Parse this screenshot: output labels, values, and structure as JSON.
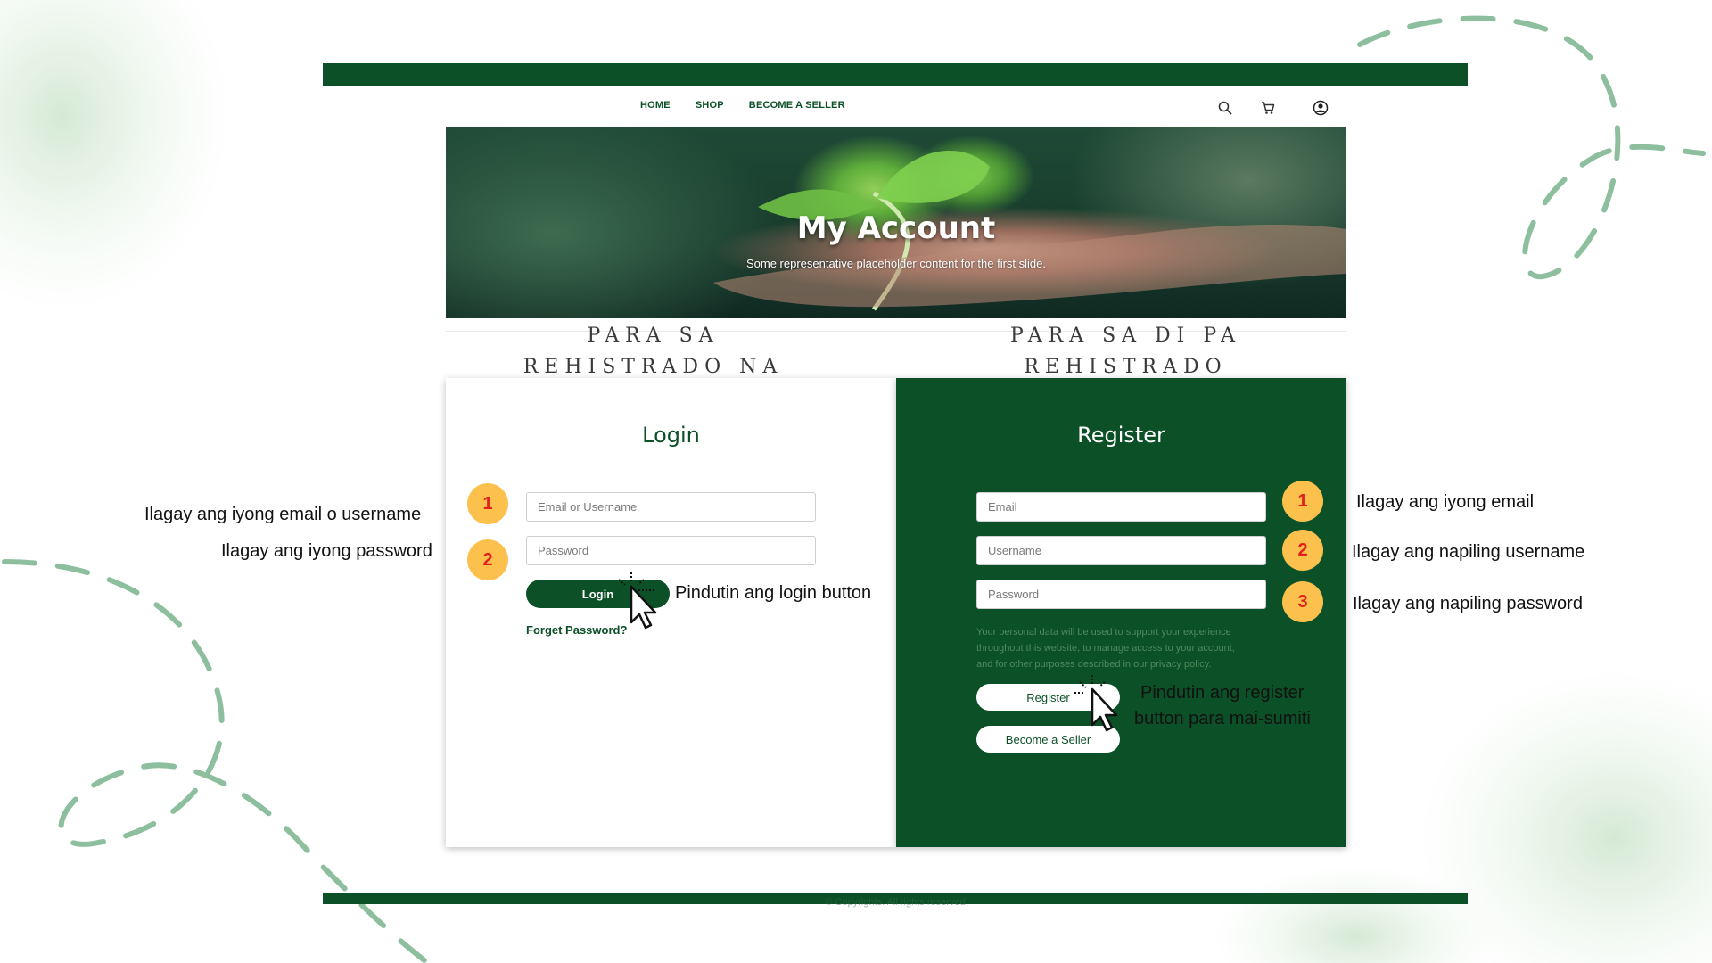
{
  "nav": {
    "items": [
      "HOME",
      "SHOP",
      "BECOME A SELLER"
    ]
  },
  "nav_icons": [
    "search-icon",
    "cart-icon",
    "account-icon"
  ],
  "hero": {
    "title": "My Account",
    "subtitle": "Some representative placeholder content for the first slide."
  },
  "sections": {
    "registered": [
      "PARA SA",
      "REHISTRADO NA"
    ],
    "not_registered": [
      "PARA SA DI PA",
      "REHISTRADO"
    ]
  },
  "login": {
    "title": "Login",
    "email_placeholder": "Email or Username",
    "password_placeholder": "Password",
    "button": "Login",
    "forget": "Forget Password?"
  },
  "register": {
    "title": "Register",
    "email_placeholder": "Email",
    "username_placeholder": "Username",
    "password_placeholder": "Password",
    "privacy_lines": [
      "Your personal data will be used to support your experience",
      "throughout this website, to manage access to your account,",
      "and for other purposes described in our privacy policy."
    ],
    "button": "Register",
    "seller_button": "Become a Seller"
  },
  "annotations": {
    "login_badges": [
      "1",
      "2"
    ],
    "register_badges": [
      "1",
      "2",
      "3"
    ],
    "login_email": "Ilagay ang iyong email o username",
    "login_password": "Ilagay ang iyong password",
    "login_button": "Pindutin ang login button",
    "reg_email": "Ilagay ang iyong email",
    "reg_username": "Ilagay ang napiling username",
    "reg_password": "Ilagay ang napiling password",
    "reg_button_1": "Pindutin ang register",
    "reg_button_2": "button para mai-sumiti"
  },
  "footer": {
    "copyright": "© Copyrights. All rights reserved"
  },
  "colors": {
    "brand_green": "#0c5027",
    "badge_yellow": "#fcc14d",
    "badge_text": "#e0201f",
    "decor_green": "#8dbf9f"
  }
}
